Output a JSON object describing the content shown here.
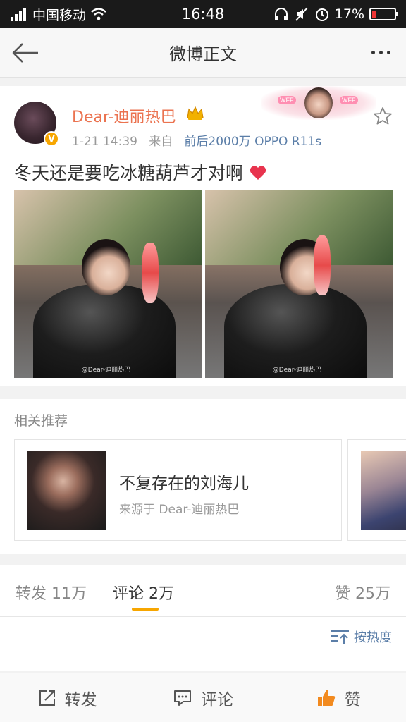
{
  "status_bar": {
    "carrier": "中国移动",
    "time": "16:48",
    "battery_percent": "17%",
    "battery_level": 0.17
  },
  "nav": {
    "title": "微博正文"
  },
  "post": {
    "username": "Dear-迪丽热巴",
    "verified_badge": "V",
    "time": "1-21 14:39",
    "from_label": "来自",
    "source": "前后2000万 OPPO R11s",
    "text": "冬天还是要吃冰糖葫芦才对啊",
    "photos": [
      {
        "watermark": "@Dear-迪丽热巴"
      },
      {
        "watermark": "@Dear-迪丽热巴"
      }
    ],
    "banner_tag": "WFF"
  },
  "recommendations": {
    "title": "相关推荐",
    "items": [
      {
        "name": "不复存在的刘海儿",
        "from": "来源于 Dear-迪丽热巴"
      }
    ]
  },
  "tabs": {
    "repost": {
      "label": "转发",
      "count": "11万"
    },
    "comment": {
      "label": "评论",
      "count": "2万"
    },
    "like": {
      "label": "赞",
      "count": "25万"
    },
    "sort_label": "按热度"
  },
  "bottom_bar": {
    "repost": "转发",
    "comment": "评论",
    "like": "赞"
  },
  "colors": {
    "accent": "#f7a600",
    "username": "#eb7350",
    "link": "#5b7ea8",
    "heart": "#e8344e"
  }
}
